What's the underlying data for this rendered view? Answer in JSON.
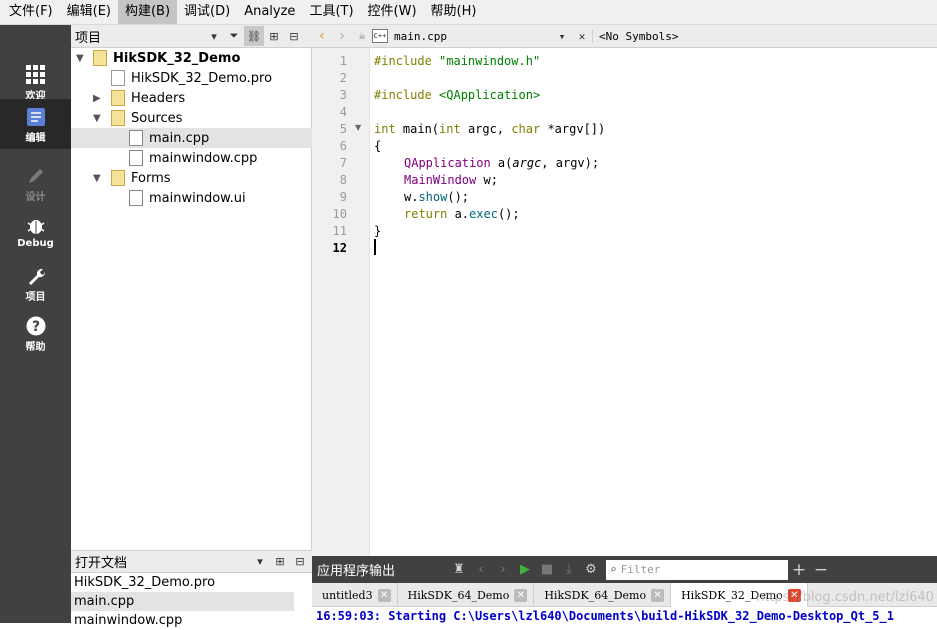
{
  "menu": [
    "文件(F)",
    "编辑(E)",
    "构建(B)",
    "调试(D)",
    "Analyze",
    "工具(T)",
    "控件(W)",
    "帮助(H)"
  ],
  "modes": [
    "欢迎",
    "编辑",
    "设计",
    "Debug",
    "项目",
    "帮助"
  ],
  "project_panel": {
    "title": "项目"
  },
  "tree": {
    "project": "HikSDK_32_Demo",
    "pro_file": "HikSDK_32_Demo.pro",
    "headers": "Headers",
    "sources": "Sources",
    "main_cpp": "main.cpp",
    "mainwindow_cpp": "mainwindow.cpp",
    "forms": "Forms",
    "mainwindow_ui": "mainwindow.ui"
  },
  "open_docs": {
    "title": "打开文档",
    "items": [
      "HikSDK_32_Demo.pro",
      "main.cpp",
      "mainwindow.cpp"
    ]
  },
  "editor": {
    "file": "main.cpp",
    "symbols": "<No Symbols>",
    "line_numbers": [
      "1",
      "2",
      "3",
      "4",
      "5",
      "6",
      "7",
      "8",
      "9",
      "10",
      "11",
      "12"
    ],
    "lines": {
      "l1_directive": "#include",
      "l1_arg": " \"mainwindow.h\"",
      "l3_directive": "#include",
      "l3_arg": " <QApplication>",
      "l5_t1": "int",
      "l5_t2": " main(",
      "l5_t3": "int",
      "l5_t4": " argc, ",
      "l5_t5": "char",
      "l5_t6": " *argv[])",
      "l6": "{",
      "l7_cls": "QApplication",
      "l7_a": " a(",
      "l7_argc": "argc",
      "l7_b": ", argv);",
      "l8_cls": "MainWindow",
      "l8_a": " w;",
      "l9_a": "w.",
      "l9_fn": "show",
      "l9_b": "();",
      "l10_kw": "return",
      "l10_a": " a.",
      "l10_fn": "exec",
      "l10_b": "();",
      "l11": "}"
    }
  },
  "output": {
    "title": "应用程序输出",
    "filter_placeholder": "Filter",
    "tabs": [
      "untitled3",
      "HikSDK_64_Demo",
      "HikSDK_64_Demo",
      "HikSDK_32_Demo"
    ],
    "line": "16:59:03: Starting C:\\Users\\lzl640\\Documents\\build-HikSDK_32_Demo-Desktop_Qt_5_1"
  },
  "watermark": "https://blog.csdn.net/lzl640",
  "colors": {
    "keyword": "#808000",
    "string": "#008000",
    "class": "#800080",
    "output_text": "#0000c8",
    "close_active": "#e0442c",
    "modebar": "#414141"
  }
}
